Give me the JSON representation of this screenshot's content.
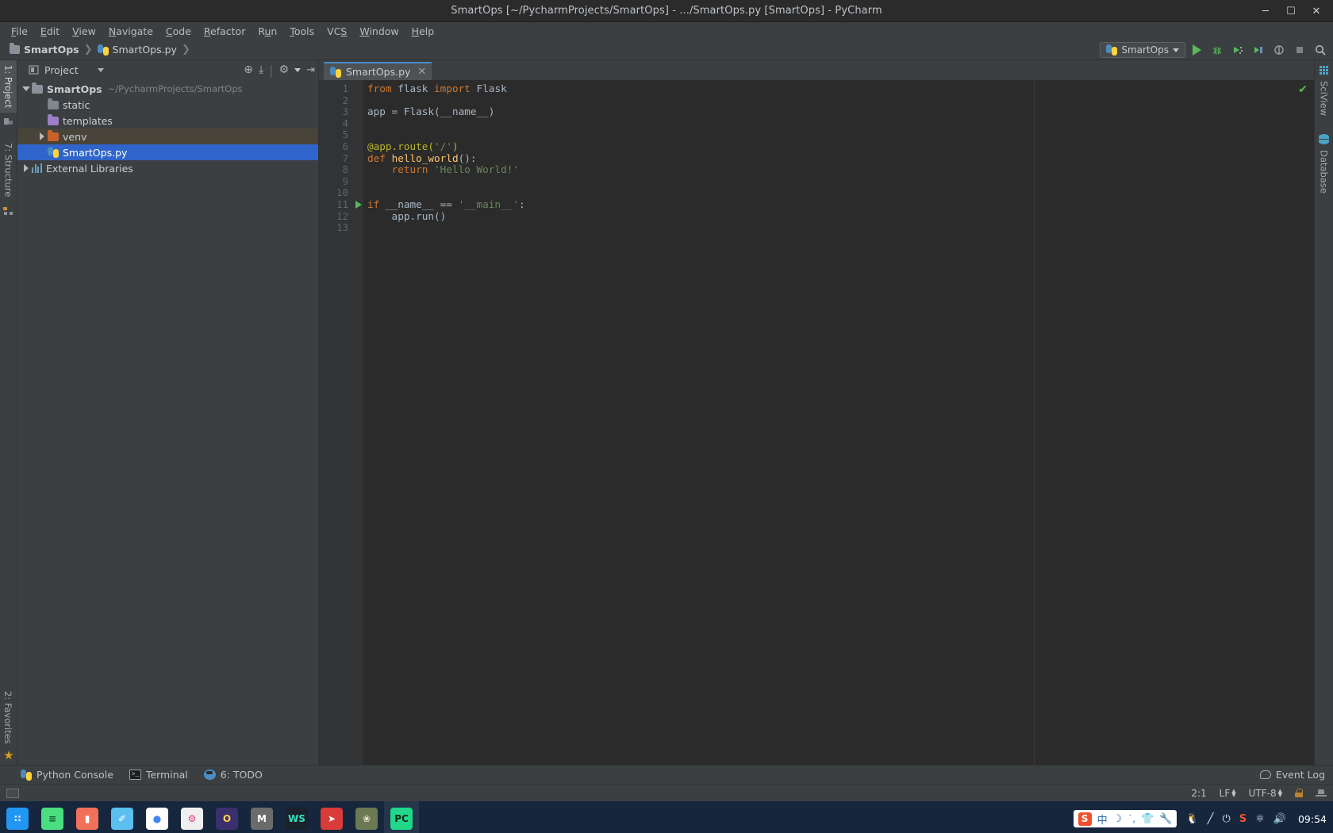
{
  "window": {
    "title": "SmartOps [~/PycharmProjects/SmartOps] - .../SmartOps.py [SmartOps] - PyCharm",
    "minimize": "─",
    "maximize": "☐",
    "close": "✕"
  },
  "menubar": [
    {
      "label": "File",
      "mnemonic": "F"
    },
    {
      "label": "Edit",
      "mnemonic": "E"
    },
    {
      "label": "View",
      "mnemonic": "V"
    },
    {
      "label": "Navigate",
      "mnemonic": "N"
    },
    {
      "label": "Code",
      "mnemonic": "C"
    },
    {
      "label": "Refactor",
      "mnemonic": "R"
    },
    {
      "label": "Run",
      "mnemonic": "u"
    },
    {
      "label": "Tools",
      "mnemonic": "T"
    },
    {
      "label": "VCS",
      "mnemonic": "S"
    },
    {
      "label": "Window",
      "mnemonic": "W"
    },
    {
      "label": "Help",
      "mnemonic": "H"
    }
  ],
  "navbar": {
    "breadcrumb": [
      {
        "label": "SmartOps",
        "icon": "folder-icon"
      },
      {
        "label": "SmartOps.py",
        "icon": "python-file-icon"
      }
    ],
    "separator": "❯",
    "run_config": {
      "label": "SmartOps",
      "icon": "python-icon"
    },
    "buttons": [
      {
        "name": "run-button",
        "icon": "play-icon"
      },
      {
        "name": "debug-button",
        "icon": "bug-icon"
      },
      {
        "name": "profile-button",
        "icon": "profiler-icon"
      },
      {
        "name": "coverage-button",
        "icon": "coverage-icon"
      },
      {
        "name": "attach-button",
        "icon": "attach-icon"
      },
      {
        "name": "stop-button",
        "icon": "stop-icon"
      },
      {
        "name": "search-button",
        "icon": "search-icon"
      }
    ]
  },
  "left_strip": {
    "tabs": [
      {
        "label": "1: Project",
        "icon": "project-icon",
        "active": true
      },
      {
        "label": "7: Structure",
        "icon": "structure-icon",
        "active": false
      }
    ],
    "bottom_tabs": [
      {
        "label": "2: Favorites",
        "icon": "star-icon"
      }
    ]
  },
  "project_panel": {
    "header": {
      "title": "Project",
      "icon": "project-view-icon"
    },
    "tools": [
      {
        "name": "locate-icon",
        "glyph": "⊕"
      },
      {
        "name": "collapse-all-icon",
        "glyph": "⤓"
      },
      {
        "name": "settings-gear-icon",
        "glyph": "⚙"
      },
      {
        "name": "hide-panel-icon",
        "glyph": "⇥"
      }
    ],
    "tree": [
      {
        "label": "SmartOps",
        "note": "~/PycharmProjects/SmartOps",
        "indent": 0,
        "twisty": "down",
        "icon": "folder-icon",
        "color": "#8a9199",
        "bold": true,
        "selected": false,
        "highlight": false
      },
      {
        "label": "static",
        "note": "",
        "indent": 1,
        "twisty": "none",
        "icon": "folder-icon",
        "color": "#7f868c",
        "bold": false,
        "selected": false,
        "highlight": false
      },
      {
        "label": "templates",
        "note": "",
        "indent": 1,
        "twisty": "none",
        "icon": "folder-icon",
        "color": "#9b7fc4",
        "bold": false,
        "selected": false,
        "highlight": false
      },
      {
        "label": "venv",
        "note": "",
        "indent": 1,
        "twisty": "right",
        "icon": "folder-icon",
        "color": "#c7622a",
        "bold": false,
        "selected": false,
        "highlight": true
      },
      {
        "label": "SmartOps.py",
        "note": "",
        "indent": 1,
        "twisty": "none",
        "icon": "python-file-icon",
        "color": "#4b8bbe",
        "bold": false,
        "selected": true,
        "highlight": false
      },
      {
        "label": "External Libraries",
        "note": "",
        "indent": 0,
        "twisty": "right",
        "icon": "library-icon",
        "color": "#6b9fbf",
        "bold": false,
        "selected": false,
        "highlight": false
      }
    ]
  },
  "editor": {
    "tab": {
      "label": "SmartOps.py",
      "icon": "python-file-icon",
      "close": "✕"
    },
    "inspection_status": "✔",
    "run_marker_line": 11,
    "lines": [
      {
        "n": 1,
        "tokens": [
          {
            "t": "from",
            "c": "kw"
          },
          {
            "t": " flask ",
            "c": "pl"
          },
          {
            "t": "import",
            "c": "kw"
          },
          {
            "t": " Flask",
            "c": "pl"
          }
        ]
      },
      {
        "n": 2,
        "tokens": []
      },
      {
        "n": 3,
        "tokens": [
          {
            "t": "app = Flask(__name__)",
            "c": "pl"
          }
        ]
      },
      {
        "n": 4,
        "tokens": []
      },
      {
        "n": 5,
        "tokens": []
      },
      {
        "n": 6,
        "tokens": [
          {
            "t": "@app.route(",
            "c": "dec"
          },
          {
            "t": "'/'",
            "c": "str"
          },
          {
            "t": ")",
            "c": "dec"
          }
        ]
      },
      {
        "n": 7,
        "tokens": [
          {
            "t": "def",
            "c": "kw"
          },
          {
            "t": " ",
            "c": "pl"
          },
          {
            "t": "hello_world",
            "c": "fn"
          },
          {
            "t": "():",
            "c": "pl"
          }
        ]
      },
      {
        "n": 8,
        "tokens": [
          {
            "t": "    ",
            "c": "pl"
          },
          {
            "t": "return",
            "c": "kw"
          },
          {
            "t": " ",
            "c": "pl"
          },
          {
            "t": "'Hello World!'",
            "c": "str"
          }
        ]
      },
      {
        "n": 9,
        "tokens": []
      },
      {
        "n": 10,
        "tokens": []
      },
      {
        "n": 11,
        "tokens": [
          {
            "t": "if",
            "c": "kw"
          },
          {
            "t": " __name__ == ",
            "c": "pl"
          },
          {
            "t": "'__main__'",
            "c": "str"
          },
          {
            "t": ":",
            "c": "pl"
          }
        ]
      },
      {
        "n": 12,
        "tokens": [
          {
            "t": "    app.run()",
            "c": "pl"
          }
        ]
      },
      {
        "n": 13,
        "tokens": []
      }
    ]
  },
  "right_strip": {
    "tabs": [
      {
        "label": "SciView",
        "icon": "grid-icon"
      },
      {
        "label": "Database",
        "icon": "database-icon"
      }
    ]
  },
  "bottom_bar": {
    "items": [
      {
        "label": "Python Console",
        "icon": "python-icon"
      },
      {
        "label": "Terminal",
        "icon": "terminal-icon"
      },
      {
        "label": "6: TODO",
        "icon": "todo-icon"
      }
    ],
    "event_log": {
      "label": "Event Log",
      "icon": "bubble-icon"
    }
  },
  "status_bar": {
    "caret_position": "2:1",
    "line_separator": "LF",
    "encoding": "UTF-8",
    "lock": "read-only-lock-icon",
    "inspector": "inspector-hat-icon"
  },
  "taskbar": {
    "apps": [
      {
        "name": "app-launcher",
        "glyph": "∷",
        "bg": "#2196f3",
        "fg": "#ffffff",
        "active": false
      },
      {
        "name": "files-app",
        "glyph": "≡",
        "bg": "#4ade80",
        "fg": "#14532d",
        "active": false
      },
      {
        "name": "media-app",
        "glyph": "▮",
        "bg": "#f1705a",
        "fg": "#ffffff",
        "active": false
      },
      {
        "name": "notes-app",
        "glyph": "✐",
        "bg": "#5bc0f0",
        "fg": "#ffffff",
        "active": false
      },
      {
        "name": "chrome-browser",
        "glyph": "●",
        "bg": "#ffffff",
        "fg": "#4285f4",
        "active": false
      },
      {
        "name": "settings-app",
        "glyph": "⚙",
        "bg": "#f0f0f0",
        "fg": "#e0407a",
        "active": false
      },
      {
        "name": "opera-browser",
        "glyph": "O",
        "bg": "#3b2f6e",
        "fg": "#ffd24a",
        "active": false
      },
      {
        "name": "mendeley-app",
        "glyph": "M",
        "bg": "#6b6b6b",
        "fg": "#ffffff",
        "active": false
      },
      {
        "name": "webstorm-ide",
        "glyph": "WS",
        "bg": "#19212b",
        "fg": "#33e0c0",
        "active": false
      },
      {
        "name": "terminal-app",
        "glyph": "➤",
        "bg": "#d93a3a",
        "fg": "#ffffff",
        "active": false
      },
      {
        "name": "photos-app",
        "glyph": "❀",
        "bg": "#6b7a52",
        "fg": "#e8e0d0",
        "active": false
      },
      {
        "name": "pycharm-ide",
        "glyph": "PC",
        "bg": "#21d789",
        "fg": "#0b2a18",
        "active": true
      }
    ],
    "tray": {
      "ime": [
        {
          "name": "sogou-icon",
          "glyph": "S"
        },
        {
          "name": "chinese-mode",
          "glyph": "中"
        },
        {
          "name": "moon-icon",
          "glyph": "☽"
        },
        {
          "name": "punctuation-icon",
          "glyph": "˙,"
        },
        {
          "name": "skin-icon",
          "glyph": "Ŧ"
        },
        {
          "name": "wrench-icon",
          "glyph": "ὒ7"
        }
      ],
      "icons": [
        {
          "name": "qq-icon",
          "glyph": "♖"
        },
        {
          "name": "pen-icon",
          "glyph": "╱"
        },
        {
          "name": "power-icon",
          "glyph": "⏻"
        },
        {
          "name": "sogou-tray-icon",
          "glyph": "S"
        },
        {
          "name": "usb-icon",
          "glyph": "Ψ"
        },
        {
          "name": "volume-icon",
          "glyph": "ὐA"
        }
      ],
      "clock": "09:54"
    }
  }
}
